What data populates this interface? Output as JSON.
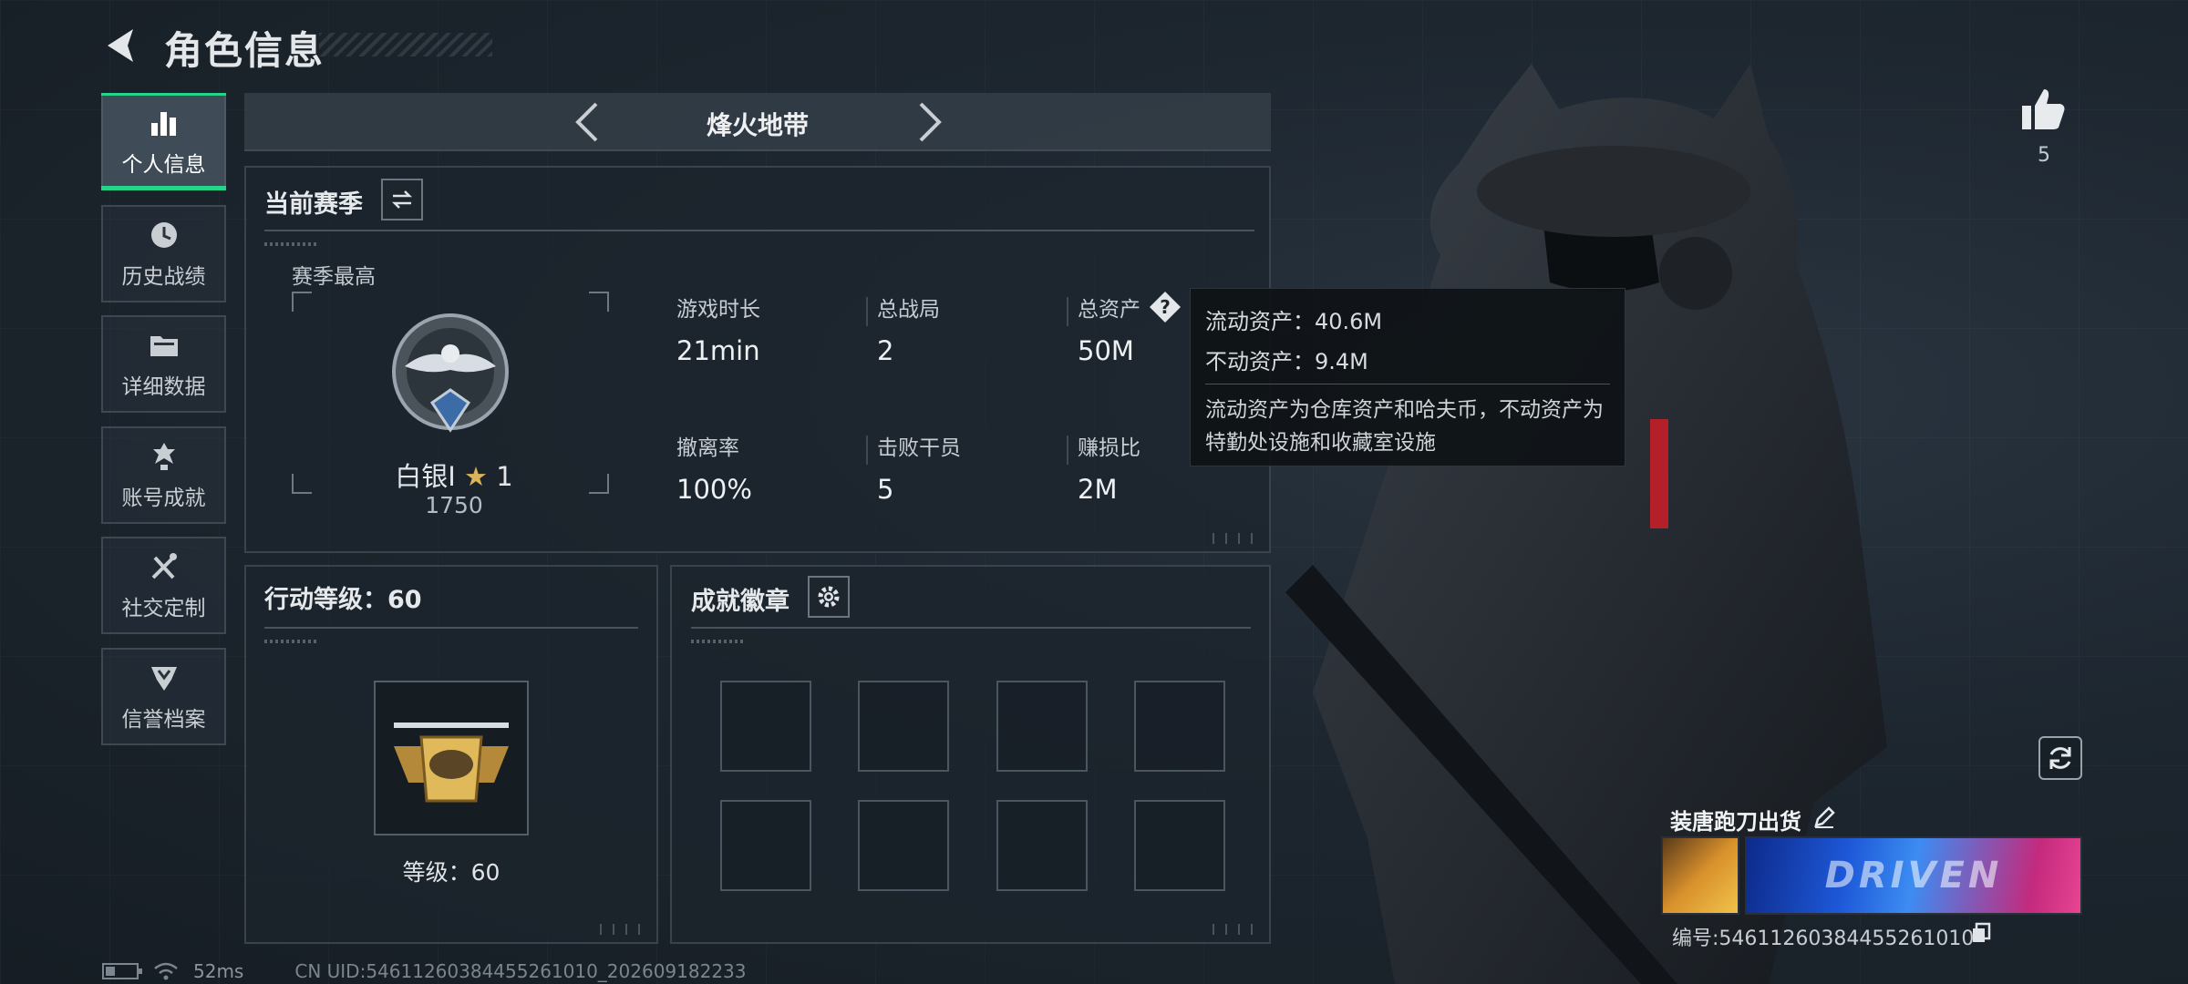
{
  "header": {
    "title": "角色信息"
  },
  "nav": {
    "items": [
      {
        "label": "个人信息",
        "icon": "bar-chart-icon",
        "active": true
      },
      {
        "label": "历史战绩",
        "icon": "history-clock-icon",
        "active": false
      },
      {
        "label": "详细数据",
        "icon": "folder-icon",
        "active": false
      },
      {
        "label": "账号成就",
        "icon": "achievement-icon",
        "active": false
      },
      {
        "label": "社交定制",
        "icon": "tools-icon",
        "active": false
      },
      {
        "label": "信誉档案",
        "icon": "shield-emblem-icon",
        "active": false
      }
    ]
  },
  "mode": {
    "title": "烽火地带"
  },
  "season": {
    "title": "当前赛季",
    "best_label": "赛季最高",
    "rank_name": "白银I",
    "rank_stars": "1",
    "rank_score": "1750",
    "stats": [
      {
        "label": "游戏时长",
        "value": "21min"
      },
      {
        "label": "总战局",
        "value": "2"
      },
      {
        "label": "总资产",
        "value": "50M"
      },
      {
        "label": "撤离率",
        "value": "100%"
      },
      {
        "label": "击败干员",
        "value": "5"
      },
      {
        "label": "赚损比",
        "value": "2M"
      }
    ]
  },
  "tooltip": {
    "liquid": "流动资产：40.6M",
    "fixed": "不动资产：9.4M",
    "desc": "流动资产为仓库资产和哈夫币，不动资产为特勤处设施和收藏室设施"
  },
  "level": {
    "title": "行动等级：60",
    "label": "等级：60"
  },
  "badges": {
    "title": "成就徽章"
  },
  "profile": {
    "likes": "5",
    "name": "装唐跑刀出货",
    "banner_text": "DRIVEN",
    "id": "编号:54611260384455261010"
  },
  "footer": {
    "ping": "52ms",
    "uid": "CN UID:54611260384455261010_202609182233"
  },
  "colors": {
    "accent": "#24d48a",
    "background": "#1b232c",
    "panel_border": "#38434d"
  }
}
